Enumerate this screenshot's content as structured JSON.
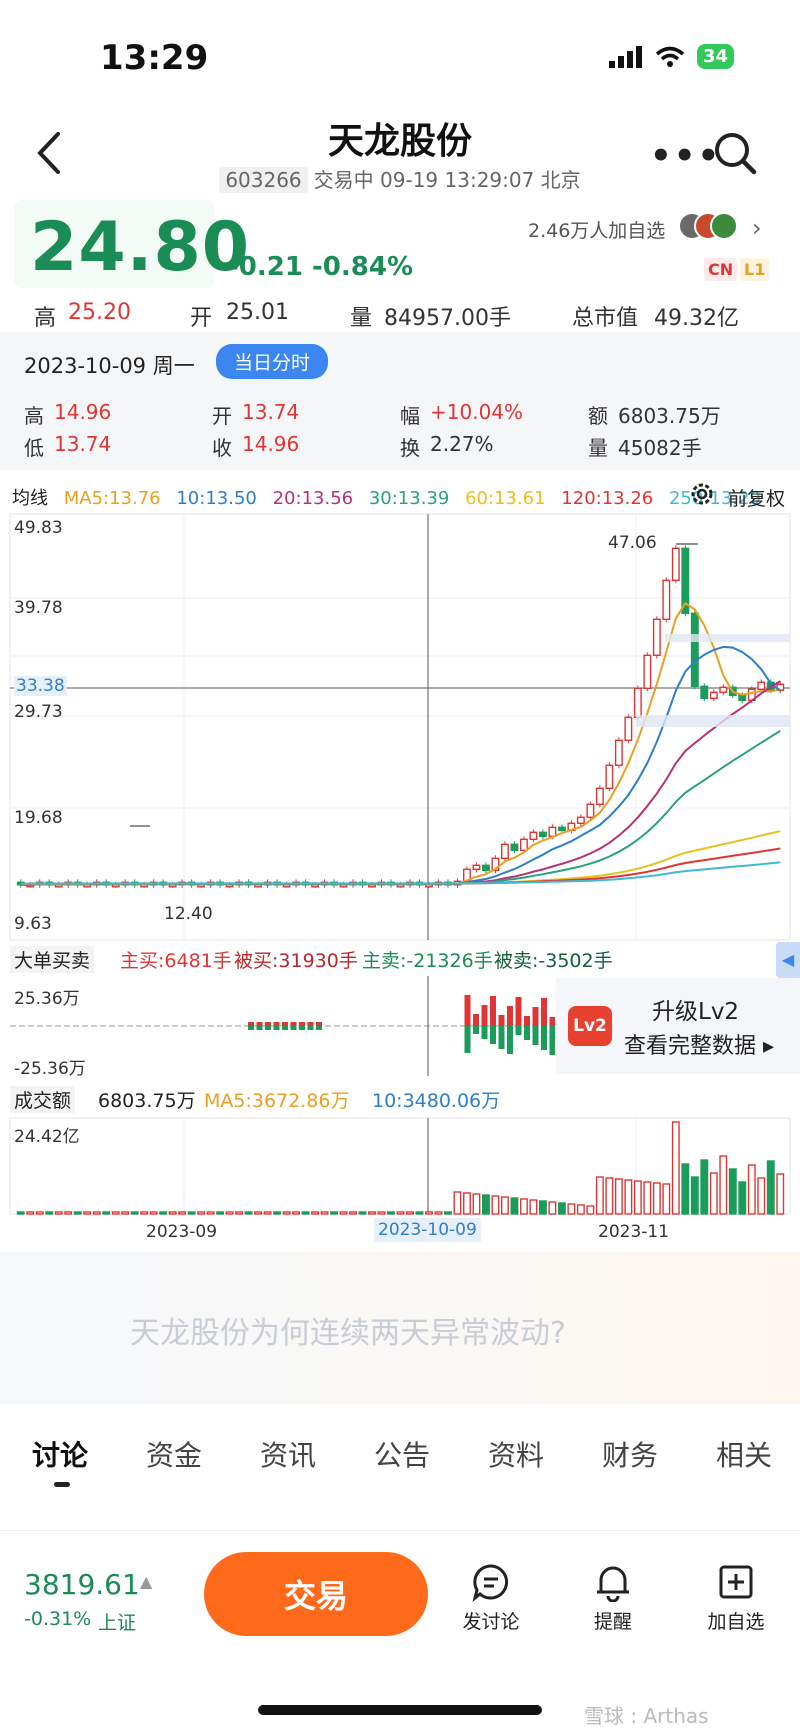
{
  "status": {
    "time": "13:29",
    "battery": "34"
  },
  "header": {
    "title": "天龙股份",
    "code": "603266",
    "status_line": "交易中 09-19 13:29:07 北京"
  },
  "quote": {
    "price": "24.80",
    "change": "-0.21",
    "change_pct": "-0.84%",
    "followers": "2.46万人加自选",
    "tag_cn": "CN",
    "tag_l1": "L1",
    "high_label": "高",
    "high": "25.20",
    "open_label": "开",
    "open": "25.01",
    "volume_label": "量",
    "volume": "84957.00手",
    "mcap_label": "总市值",
    "mcap": "49.32亿"
  },
  "day_info": {
    "date": "2023-10-09 周一",
    "day_button": "当日分时",
    "high_label": "高",
    "high": "14.96",
    "open_label": "开",
    "open": "13.74",
    "range_label": "幅",
    "range": "+10.04%",
    "amount_label": "额",
    "amount": "6803.75万",
    "low_label": "低",
    "low": "13.74",
    "close_label": "收",
    "close": "14.96",
    "turnover_label": "换",
    "turnover": "2.27%",
    "vol_label": "量",
    "vol": "45082手"
  },
  "ma_row": {
    "label": "均线",
    "ma5": "MA5:13.76",
    "ma10": "10:13.50",
    "ma20": "20:13.56",
    "ma30": "30:13.39",
    "ma60": "60:13.61",
    "ma120": "120:13.26",
    "ma250": "250:13.29",
    "adjust": "前复权",
    "colors": {
      "ma5": "#e8a020",
      "ma10": "#2d7fc9",
      "ma20": "#b8307a",
      "ma30": "#2aa080",
      "ma60": "#e8c020",
      "ma120": "#e03535",
      "ma250": "#40b8d8"
    }
  },
  "kline": {
    "y_top": "49.83",
    "y_2": "39.78",
    "y_cross": "33.38",
    "y_3": "29.73",
    "y_4": "19.68",
    "y_low": "9.63",
    "peak_label": "47.06",
    "low_label": "12.40"
  },
  "big_order": {
    "label": "大单买卖",
    "main_buy": "主买:6481手",
    "passive_buy": "被买:31930手",
    "main_sell": "主卖:-21326手",
    "passive_sell": "被卖:-3502手",
    "y_top": "25.36万",
    "y_bottom": "-25.36万",
    "lv2_badge": "Lv2",
    "lv2_title": "升级Lv2",
    "lv2_sub": "查看完整数据 ▸"
  },
  "volume": {
    "label": "成交额",
    "value": "6803.75万",
    "ma5": "MA5:3672.86万",
    "ma10": "10:3480.06万",
    "y_top": "24.42亿",
    "x_labels": [
      "2023-09",
      "2023-10-09",
      "2023-11"
    ]
  },
  "news": {
    "headline": "天龙股份为何连续两天异常波动?"
  },
  "tabs": [
    "讨论",
    "资金",
    "资讯",
    "公告",
    "资料",
    "财务",
    "相关"
  ],
  "bottom": {
    "index_value": "3819.61",
    "index_change": "-0.31%",
    "index_name": "上证",
    "trade": "交易",
    "discuss": "发讨论",
    "alert": "提醒",
    "add": "加自选"
  },
  "watermark": "雪球 : Arthas"
}
